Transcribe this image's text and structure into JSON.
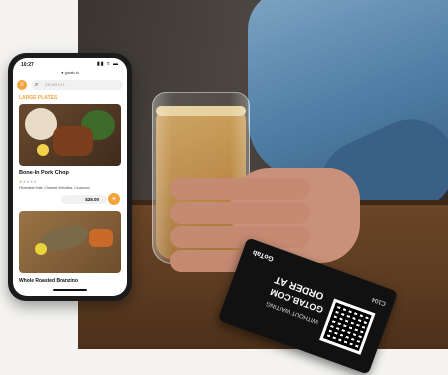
{
  "phone": {
    "status_time": "10:27",
    "status_icons": "▮▮ ≈ ▬",
    "url": "● gotab.io",
    "menu_icon": "menu-icon",
    "search_placeholder": "SEARCH...",
    "section_title": "LARGE PLATES",
    "items": [
      {
        "title": "Bone-In Pork Chop",
        "stars": "★",
        "stars_muted": "★★★★",
        "description": "Florentine Kale, Charred Shishitos, Couscous",
        "price": "$28.00",
        "add_label": "+"
      }
    ],
    "next_item_title": "Whole Roasted Branzino"
  },
  "card": {
    "brand": "GoTab",
    "line1": "ORDER AT",
    "line2": "GOTAB.COM",
    "line3": "WITHOUT WAITING",
    "tag": "C104"
  },
  "colors": {
    "accent": "#f3a33a",
    "phone_frame": "#1b1b1d"
  }
}
